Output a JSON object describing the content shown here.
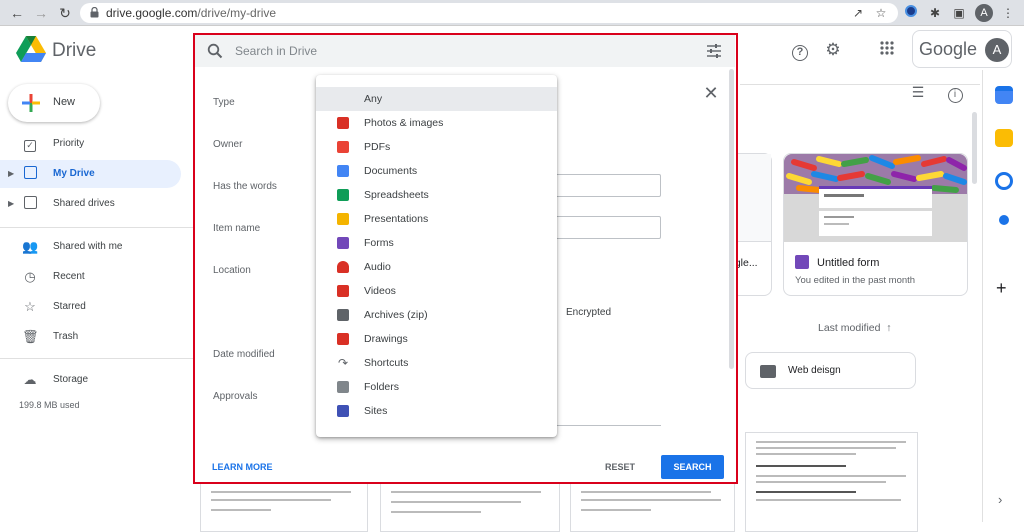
{
  "browser": {
    "url_host": "drive.google.com",
    "url_path": "/drive/my-drive",
    "profile_initial": "A"
  },
  "header": {
    "app_name": "Drive",
    "google_word": "Google",
    "account_initial": "A"
  },
  "sidebar": {
    "new_label": "New",
    "items": [
      {
        "label": "Priority",
        "icon": "checkbox-icon"
      },
      {
        "label": "My Drive",
        "icon": "drive-icon",
        "active": true
      },
      {
        "label": "Shared drives",
        "icon": "shared-drives-icon"
      },
      {
        "label": "Shared with me",
        "icon": "people-icon"
      },
      {
        "label": "Recent",
        "icon": "clock-icon"
      },
      {
        "label": "Starred",
        "icon": "star-icon"
      },
      {
        "label": "Trash",
        "icon": "trash-icon"
      },
      {
        "label": "Storage",
        "icon": "cloud-icon"
      }
    ],
    "storage_used": "199.8 MB used"
  },
  "main": {
    "form_card": {
      "title": "Untitled form",
      "subtitle": "You edited in the past month"
    },
    "partial_card_label": "ogle...",
    "sort_label": "Last modified",
    "folder_name": "Web deisgn"
  },
  "search": {
    "placeholder": "Search in Drive",
    "fields": {
      "type": "Type",
      "owner": "Owner",
      "has_words": "Has the words",
      "item_name": "Item name",
      "location": "Location",
      "date_modified": "Date modified",
      "approvals": "Approvals"
    },
    "encrypted_label": "Encrypted",
    "learn_more": "LEARN MORE",
    "reset": "RESET",
    "search_btn": "SEARCH"
  },
  "type_menu": {
    "items": [
      {
        "label": "Any",
        "color": "",
        "selected": true
      },
      {
        "label": "Photos & images",
        "color": "#d93025"
      },
      {
        "label": "PDFs",
        "color": "#ea4335"
      },
      {
        "label": "Documents",
        "color": "#4285f4"
      },
      {
        "label": "Spreadsheets",
        "color": "#0f9d58"
      },
      {
        "label": "Presentations",
        "color": "#f4b400"
      },
      {
        "label": "Forms",
        "color": "#7248b9"
      },
      {
        "label": "Audio",
        "color": "#d93025"
      },
      {
        "label": "Videos",
        "color": "#d93025"
      },
      {
        "label": "Archives (zip)",
        "color": "#5f6368"
      },
      {
        "label": "Drawings",
        "color": "#d93025"
      },
      {
        "label": "Shortcuts",
        "color": "#5f6368"
      },
      {
        "label": "Folders",
        "color": "#80868b"
      },
      {
        "label": "Sites",
        "color": "#3f51b5"
      }
    ]
  }
}
